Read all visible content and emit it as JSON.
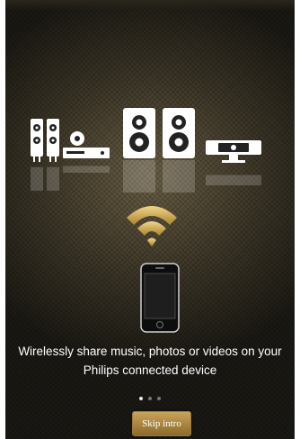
{
  "intro": {
    "devices": [
      "hifi-system-icon",
      "speakers-icon",
      "soundbar-icon"
    ],
    "caption": "Wirelessly share music, photos or videos on your Philips connected device",
    "pagination": {
      "current": 1,
      "total": 3
    },
    "skip_label": "Skip intro"
  },
  "colors": {
    "accent_gold": "#c9a35a",
    "dot_active": "#f0f0f0",
    "dot_inactive": "#7c7668"
  }
}
